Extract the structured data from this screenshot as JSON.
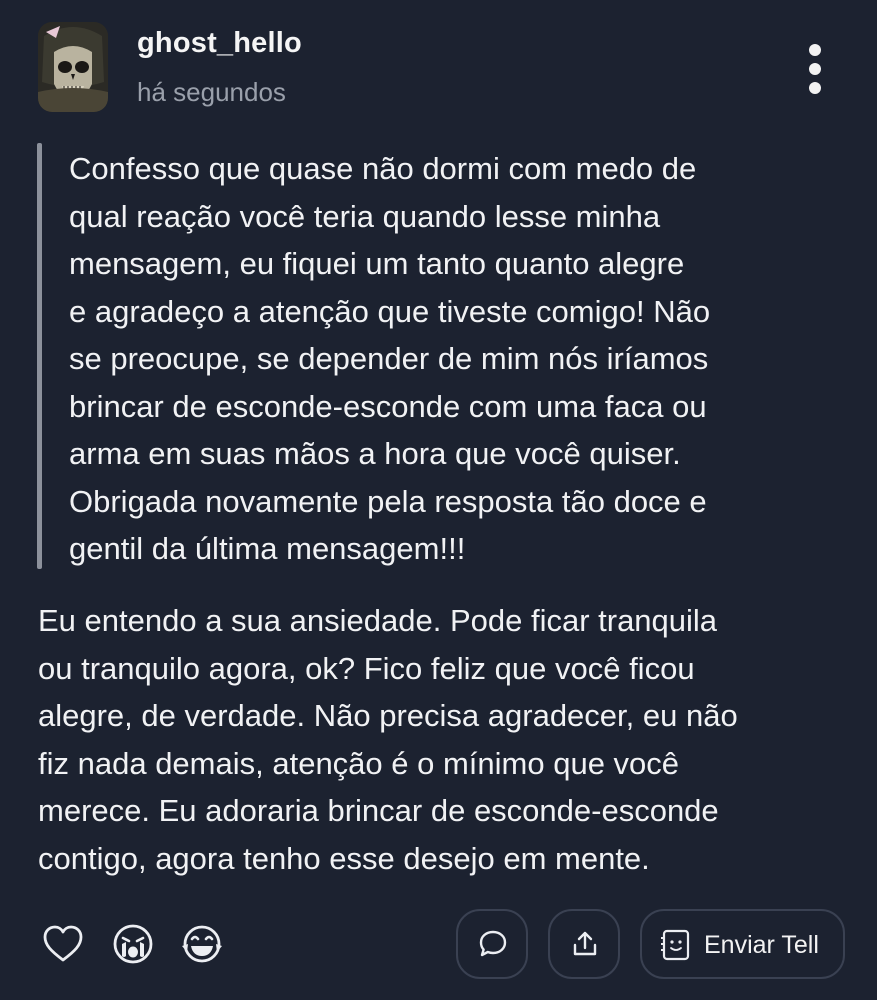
{
  "post": {
    "username": "ghost_hello",
    "timestamp": "há segundos",
    "quote_text": "Confesso que quase não dormi com medo de\nqual reação você teria quando lesse minha\nmensagem, eu fiquei um tanto quanto alegre\ne agradeço a atenção que tiveste comigo! Não\nse preocupe, se depender de mim nós iríamos\nbrincar de esconde-esconde com uma faca ou\narma em suas mãos a hora que você quiser.\nObrigada novamente pela resposta tão doce e\ngentil da última mensagem!!!",
    "reply_text": "Eu entendo a sua ansiedade. Pode ficar tranquila\nou tranquilo agora, ok? Fico feliz que você ficou\nalegre, de verdade. Não precisa agradecer, eu não\nfiz nada demais, atenção é o mínimo que você\nmerece. Eu adoraria brincar de esconde-esconde\ncontigo, agora tenho esse desejo em mente."
  },
  "actions": {
    "send_tell_label": "Enviar Tell"
  },
  "colors": {
    "background": "#1c2230",
    "text": "#f1f2f4",
    "muted": "#9aa0ab",
    "quote_bar": "#8c919b",
    "pill_border": "#3a4152"
  },
  "icons": {
    "menu": "more-vertical-icon",
    "reactions": [
      "heart-icon",
      "crying-face-icon",
      "laughing-face-icon"
    ],
    "comment": "comment-icon",
    "share": "share-icon",
    "tell": "tell-card-icon"
  }
}
